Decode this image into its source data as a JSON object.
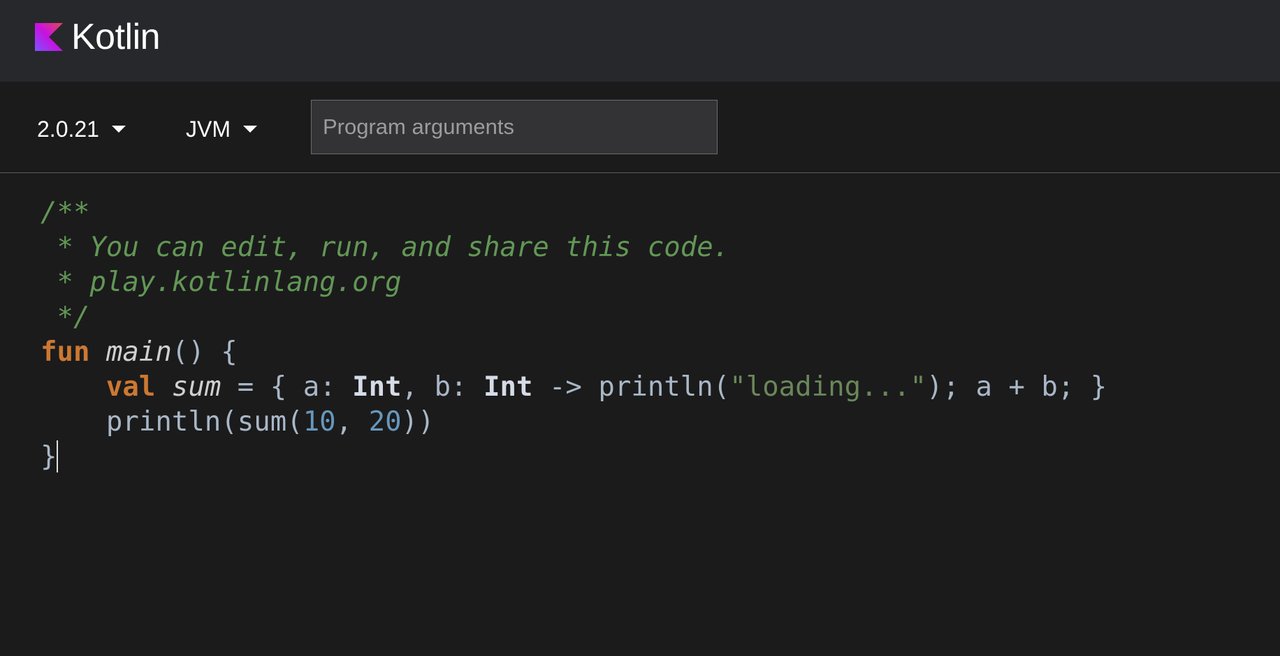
{
  "header": {
    "logo_text": "Kotlin",
    "brand_colors": [
      "#7f52ff",
      "#c711e1",
      "#e44857"
    ]
  },
  "toolbar": {
    "version": {
      "label": "2.0.21",
      "icon": "caret-down-icon"
    },
    "target": {
      "label": "JVM",
      "icon": "caret-down-icon"
    },
    "args_input": {
      "value": "",
      "placeholder": "Program arguments"
    }
  },
  "editor": {
    "lines": {
      "l1": {
        "comment": "/**"
      },
      "l2": {
        "comment": " * You can edit, run, and share this code."
      },
      "l3": {
        "comment": " * play.kotlinlang.org"
      },
      "l4": {
        "comment": " */"
      },
      "l5": {
        "kw": "fun",
        "sp": " ",
        "name": "main",
        "rest": "() {"
      },
      "l6": {
        "indent": "    ",
        "kw": "val",
        "sp1": " ",
        "name": "sum",
        "p1": " = { a: ",
        "type1": "Int",
        "p2": ", b: ",
        "type2": "Int",
        "p3": " -> println(",
        "str": "\"loading...\"",
        "p4": "); a + b; }"
      },
      "l7": {
        "indent": "    ",
        "p1": "println(sum(",
        "num1": "10",
        "p2": ", ",
        "num2": "20",
        "p3": "))"
      },
      "l8": {
        "text": "}"
      }
    },
    "colors": {
      "comment": "#629755",
      "keyword": "#cc7832",
      "string": "#6a8759",
      "number": "#6897bb",
      "default": "#a9b7c6"
    }
  }
}
